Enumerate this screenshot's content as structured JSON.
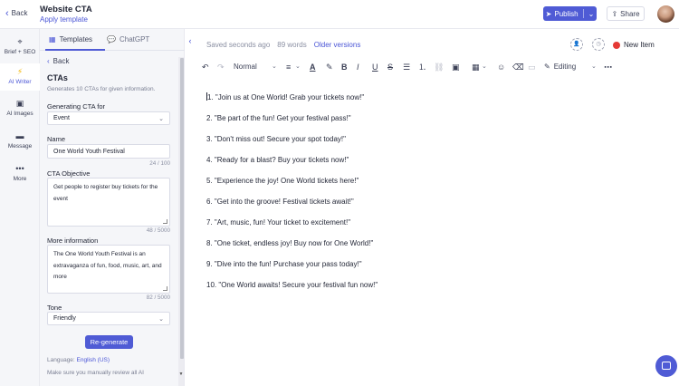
{
  "header": {
    "back_label": "Back",
    "doc_title": "Website CTA",
    "apply_template": "Apply template",
    "publish_label": "Publish",
    "share_label": "Share"
  },
  "leftnav": {
    "items": [
      {
        "label": "Brief + SEO",
        "icon": "target-icon"
      },
      {
        "label": "AI Writer",
        "icon": "lightning-icon"
      },
      {
        "label": "AI Images",
        "icon": "image-icon"
      },
      {
        "label": "Message",
        "icon": "chat-icon"
      },
      {
        "label": "More",
        "icon": "more-icon"
      }
    ]
  },
  "panel": {
    "tabs": [
      {
        "label": "Templates"
      },
      {
        "label": "ChatGPT"
      }
    ],
    "back_label": "Back",
    "title": "CTAs",
    "subtitle": "Generates 10 CTAs for given information.",
    "generating_label": "Generating CTA for",
    "generating_value": "Event",
    "name_label": "Name",
    "name_value": "One World Youth Festival",
    "name_count": "24 / 100",
    "objective_label": "CTA Objective",
    "objective_value": "Get people to register buy tickets for the event",
    "objective_count": "48 / 5000",
    "more_label": "More information",
    "more_value": "The One World Youth Festival is an extravaganza of fun, food, music, art, and more",
    "more_count": "82 / 5000",
    "tone_label": "Tone",
    "tone_value": "Friendly",
    "regenerate_label": "Re-generate",
    "language_prefix": "Language:",
    "language_value": "English (US)",
    "review_note": "Make sure you manually review all AI"
  },
  "editor": {
    "saved_text": "Saved seconds ago",
    "word_count": "89 words",
    "older_versions": "Older versions",
    "new_item": "New Item",
    "style_value": "Normal",
    "mode_value": "Editing",
    "items": [
      {
        "num": "1.",
        "text": "\"Join us at One World! Grab your tickets now!\""
      },
      {
        "num": "2.",
        "text": "\"Be part of the fun! Get your festival pass!\""
      },
      {
        "num": "3.",
        "text": "\"Don't miss out! Secure your spot today!\""
      },
      {
        "num": "4.",
        "text": "\"Ready for a blast? Buy your tickets now!\""
      },
      {
        "num": "5.",
        "text": "\"Experience the joy! One World tickets here!\""
      },
      {
        "num": "6.",
        "text": "\"Get into the groove! Festival tickets await!\""
      },
      {
        "num": "7.",
        "text": "\"Art, music, fun! Your ticket to excitement!\""
      },
      {
        "num": "8.",
        "text": "\"One ticket, endless joy! Buy now for One World!\""
      },
      {
        "num": "9.",
        "text": "\"Dive into the fun! Purchase your pass today!\""
      },
      {
        "num": "10.",
        "text": "\"One World awaits! Secure your festival fun now!\""
      }
    ]
  },
  "colors": {
    "accent": "#4f5bd5",
    "new_item_dot": "#e53935",
    "ai_writer_icon": "#f2b400"
  }
}
